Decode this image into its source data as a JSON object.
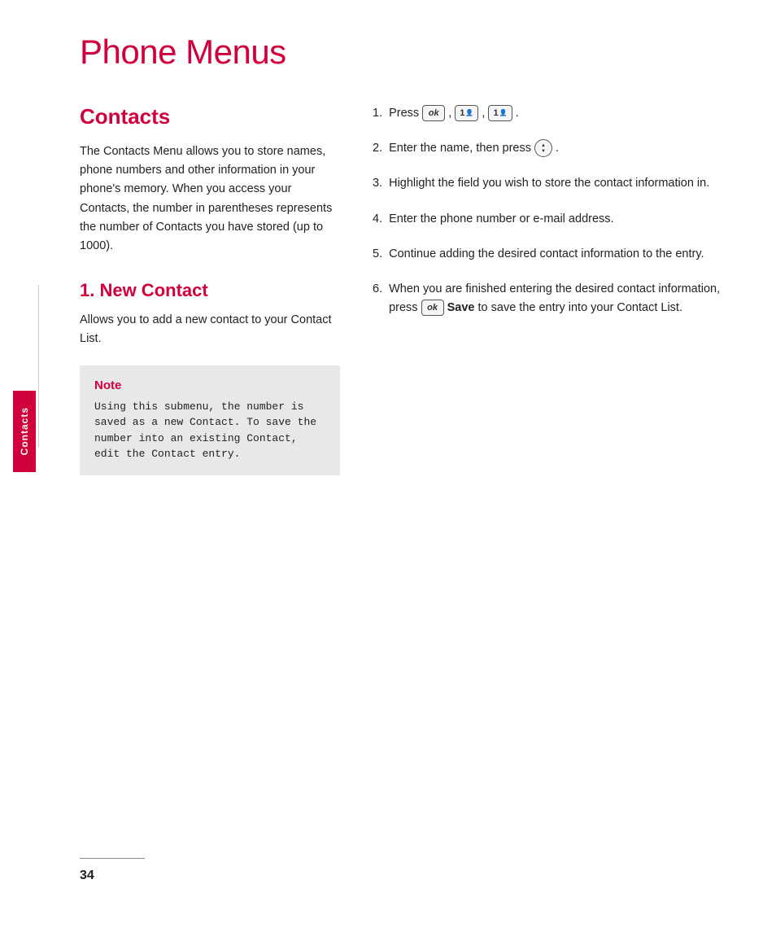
{
  "page": {
    "title": "Phone Menus",
    "page_number": "34"
  },
  "sidebar": {
    "label": "Contacts"
  },
  "contacts_section": {
    "heading": "Contacts",
    "body": "The Contacts Menu allows you to store names, phone numbers and other information in your phone's memory. When you access your Contacts, the number in parentheses represents the number of Contacts you have stored (up to 1000)."
  },
  "new_contact_section": {
    "heading": "1. New Contact",
    "body": "Allows you to add a new contact to your Contact List."
  },
  "note_box": {
    "title": "Note",
    "text": "Using this submenu, the number is saved as a new Contact. To save the number into an existing Contact, edit the Contact entry."
  },
  "steps": [
    {
      "number": "1.",
      "text": "Press [OK] , [1▲] , [1▲] ."
    },
    {
      "number": "2.",
      "text": "Enter the name, then press [nav] ."
    },
    {
      "number": "3.",
      "text": "Highlight the field you wish to store the contact information in."
    },
    {
      "number": "4.",
      "text": "Enter the phone number or e-mail address."
    },
    {
      "number": "5.",
      "text": "Continue adding the desired contact information to the entry."
    },
    {
      "number": "6.",
      "text": "When you are finished entering the desired contact information, press [OK] Save to save the entry into your Contact List."
    }
  ],
  "buttons": {
    "ok_label": "ok",
    "key1_label": "1",
    "save_label": "Save"
  }
}
